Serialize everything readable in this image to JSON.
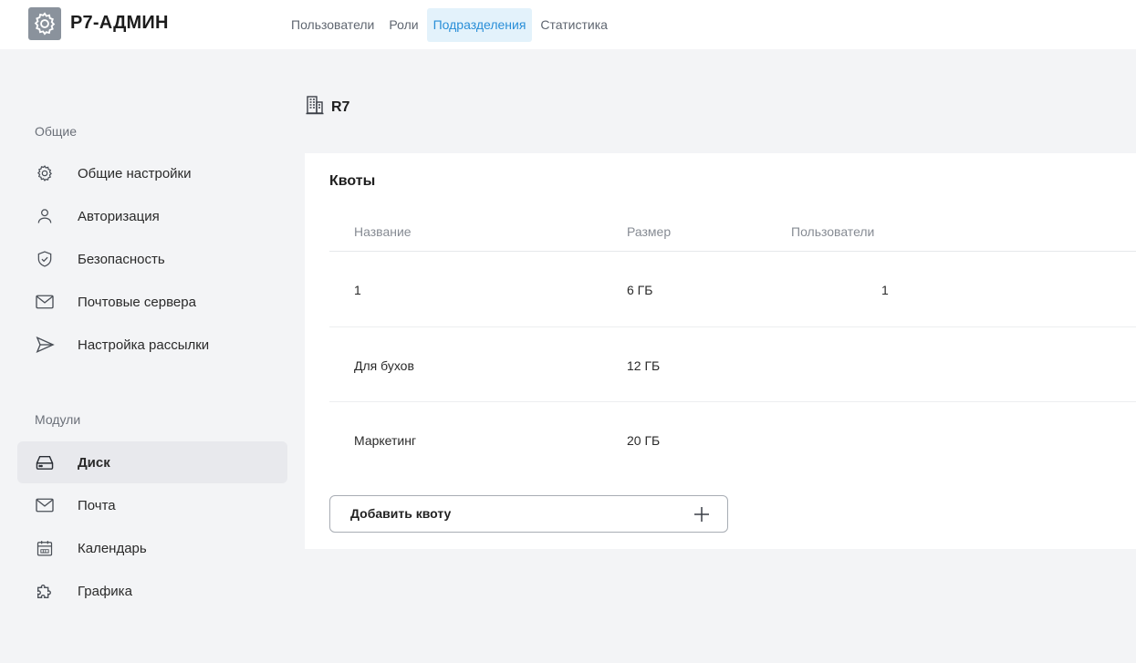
{
  "app": {
    "title": "Р7-АДМИН",
    "logo_icon": "gear-icon",
    "logo_bg": "#8a929c"
  },
  "nav": {
    "items": [
      {
        "label": "Пользователи",
        "active": false
      },
      {
        "label": "Роли",
        "active": false
      },
      {
        "label": "Подразделения",
        "active": true
      },
      {
        "label": "Статистика",
        "active": false
      }
    ],
    "active_color": "#2a8fd8",
    "active_bg": "#e3f2fb"
  },
  "sidebar": {
    "general_label": "Общие",
    "general_items": [
      {
        "label": "Общие настройки",
        "icon": "gear-icon"
      },
      {
        "label": "Авторизация",
        "icon": "user-icon"
      },
      {
        "label": "Безопасность",
        "icon": "shield-check-icon"
      },
      {
        "label": "Почтовые сервера",
        "icon": "envelope-icon"
      },
      {
        "label": "Настройка рассылки",
        "icon": "send-icon"
      }
    ],
    "modules_label": "Модули",
    "module_items": [
      {
        "label": "Диск",
        "icon": "drive-icon",
        "active": true
      },
      {
        "label": "Почта",
        "icon": "envelope-icon",
        "active": false
      },
      {
        "label": "Календарь",
        "icon": "calendar-icon",
        "active": false
      },
      {
        "label": "Графика",
        "icon": "puzzle-icon",
        "active": false
      }
    ]
  },
  "main": {
    "unit_name": "R7",
    "unit_icon": "building-icon",
    "quotas": {
      "title": "Квоты",
      "columns": [
        "Название",
        "Размер",
        "Пользователи"
      ],
      "rows": [
        {
          "name": "1",
          "size": "6 ГБ",
          "users": "1"
        },
        {
          "name": "Для бухов",
          "size": "12 ГБ",
          "users": ""
        },
        {
          "name": "Маркетинг",
          "size": "20 ГБ",
          "users": ""
        }
      ],
      "add_label": "Добавить квоту",
      "add_icon": "plus-icon"
    }
  }
}
